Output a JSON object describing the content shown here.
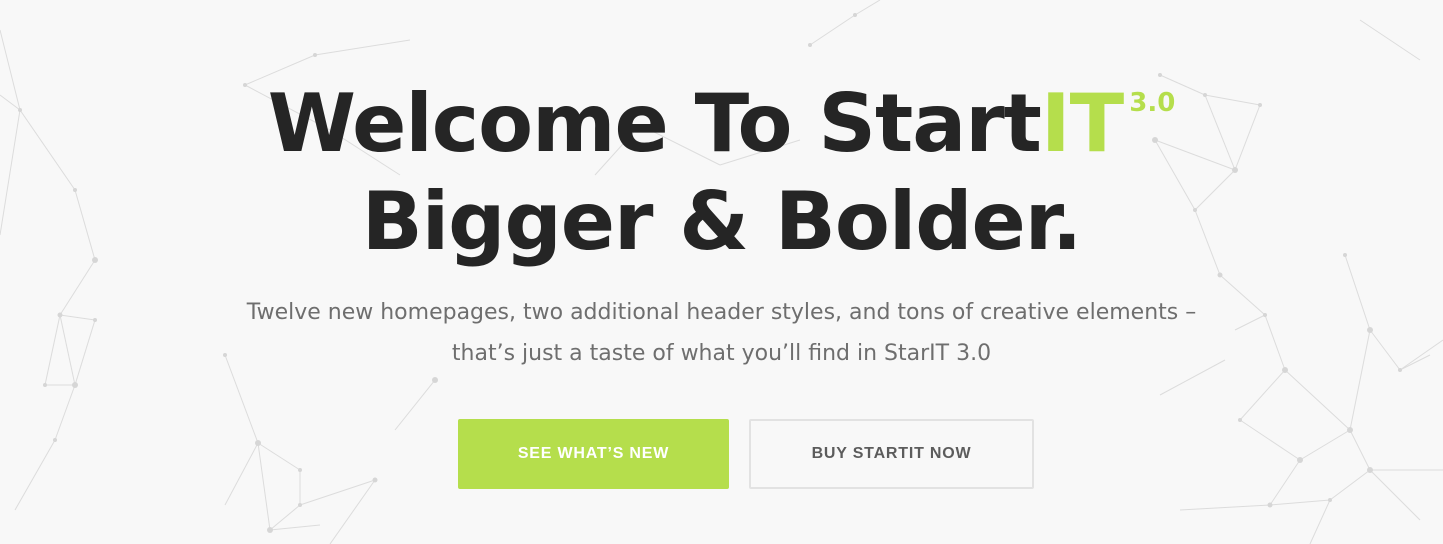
{
  "hero": {
    "title_line1_prefix": "Welcome To Start",
    "title_line1_accent": "IT",
    "version_badge": "3.0",
    "title_line2": "Bigger & Bolder.",
    "subtitle_line1": "Twelve new homepages, two additional header styles, and tons of creative elements –",
    "subtitle_line2": "that’s just a taste of what you’ll find in StarIT 3.0"
  },
  "buttons": {
    "primary_label": "SEE WHAT’S NEW",
    "secondary_label": "BUY STARTIT NOW"
  },
  "colors": {
    "accent": "#b5de4c",
    "heading": "#252525",
    "body_text": "#6e6e6e",
    "background": "#f8f8f8",
    "secondary_button_border": "#e2e2e2"
  },
  "background": {
    "decoration": "network-lines-pattern"
  }
}
